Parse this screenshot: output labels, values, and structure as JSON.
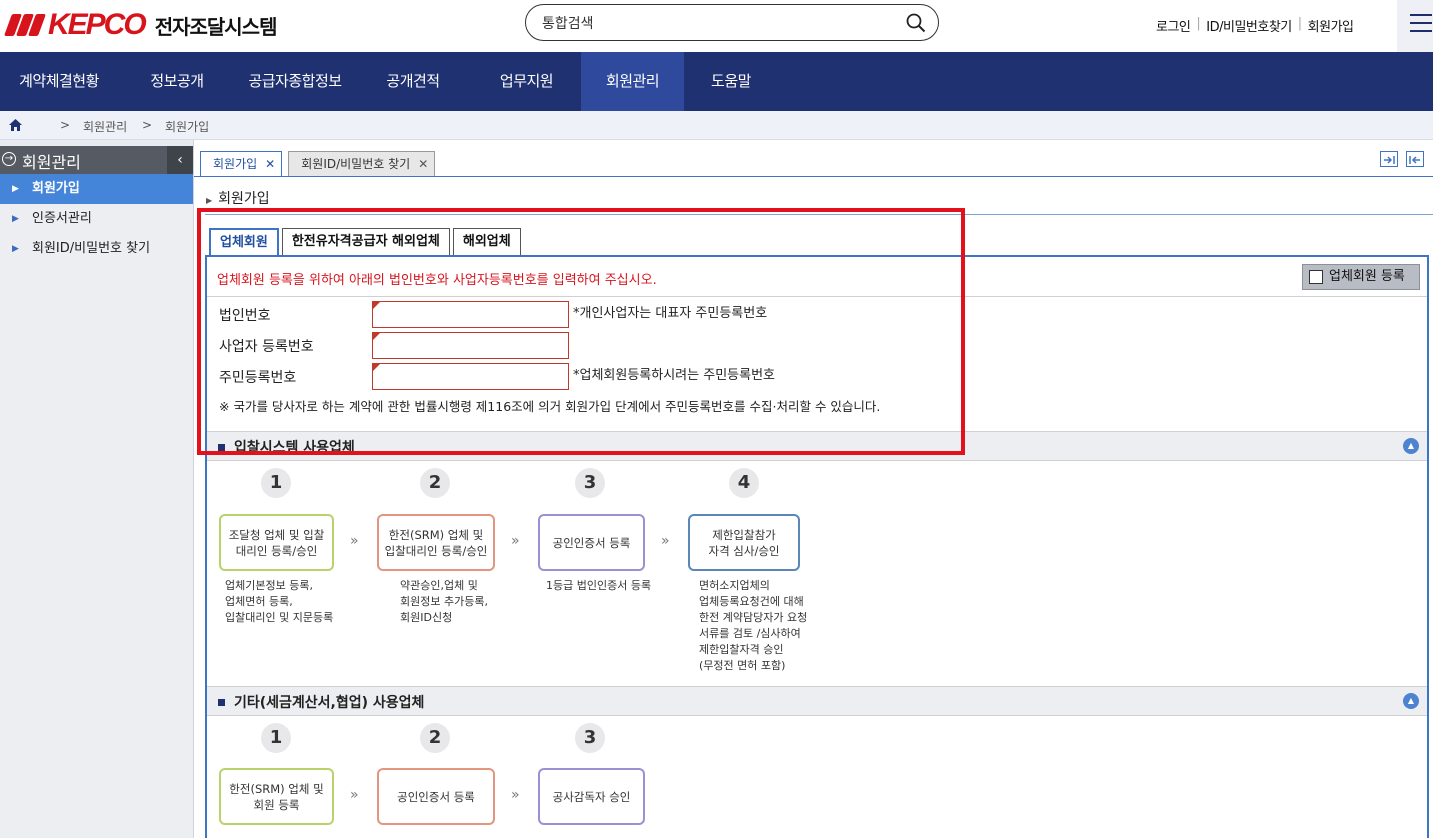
{
  "header": {
    "logo_text": "KEPCO",
    "system_title": "전자조달시스템",
    "search_value": "통합검색",
    "links": [
      "로그인",
      "ID/비밀번호찾기",
      "회원가입"
    ]
  },
  "gnb": [
    {
      "label": "계약체결현황",
      "active": false
    },
    {
      "label": "정보공개",
      "active": false
    },
    {
      "label": "공급자종합정보",
      "active": false
    },
    {
      "label": "공개견적",
      "active": false
    },
    {
      "label": "업무지원",
      "active": false
    },
    {
      "label": "회원관리",
      "active": true
    },
    {
      "label": "도움말",
      "active": false
    }
  ],
  "breadcrumb": [
    "회원관리",
    "회원가입"
  ],
  "lnb": {
    "title": "회원관리",
    "items": [
      "회원가입",
      "인증서관리",
      "회원ID/비밀번호 찾기"
    ]
  },
  "window_tabs": [
    "회원가입",
    "회원ID/비밀번호 찾기"
  ],
  "page_title": "회원가입",
  "content_tabs": [
    "업체회원",
    "한전유자격공급자 해외업체",
    "해외업체"
  ],
  "form": {
    "notice": "업체회원 등록을 위하여 아래의 법인번호와 사업자등록번호를 입력하여 주십시오.",
    "register_button": "업체회원 등록",
    "fields": [
      {
        "label": "법인번호",
        "value": "",
        "note": "*개인사업자는 대표자 주민등록번호"
      },
      {
        "label": "사업자 등록번호",
        "value": "",
        "note": ""
      },
      {
        "label": "주민등록번호",
        "value": "",
        "note": "*업체회원등록하시려는 주민등록번호"
      }
    ],
    "legal": "※ 국가를 당사자로 하는 계약에 관한 법률시행령 제116조에 의거 회원가입 단계에서 주민등록번호를 수집·처리할 수 있습니다."
  },
  "section1": {
    "title": "입찰시스템 사용업체",
    "steps": [
      {
        "num": "1",
        "box": "조달청 업체 및 입찰\n대리인 등록/승인",
        "desc": "업체기본정보 등록,\n업체면허 등록,\n입찰대리인 및 지문등록"
      },
      {
        "num": "2",
        "box": "한전(SRM) 업체 및\n입찰대리인 등록/승인",
        "desc": "약관승인,업체 및\n회원정보 추가등록,\n회원ID신청"
      },
      {
        "num": "3",
        "box": "공인인증서 등록",
        "desc": "1등급 법인인증서 등록"
      },
      {
        "num": "4",
        "box": "제한입찰참가\n자격 심사/승인",
        "desc": "면허소지업체의\n업체등록요청건에 대해\n한전 계약담당자가 요청\n서류를 검토 /심사하여\n제한입찰자격 승인\n(무정전 면허 포함)"
      }
    ]
  },
  "section2": {
    "title": "기타(세금계산서,협업) 사용업체",
    "steps": [
      {
        "num": "1",
        "box": "한전(SRM) 업체 및\n회원 등록"
      },
      {
        "num": "2",
        "box": "공인인증서 등록"
      },
      {
        "num": "3",
        "box": "공사감독자 승인"
      }
    ]
  },
  "colors": {
    "navy": "#1f3170",
    "accent_blue": "#3d74c6",
    "highlight_red": "#e3111b",
    "step_green": "#b9d26b",
    "step_salmon": "#e2957f",
    "step_purple": "#9d8fd3",
    "step_blue": "#5a86b8"
  }
}
